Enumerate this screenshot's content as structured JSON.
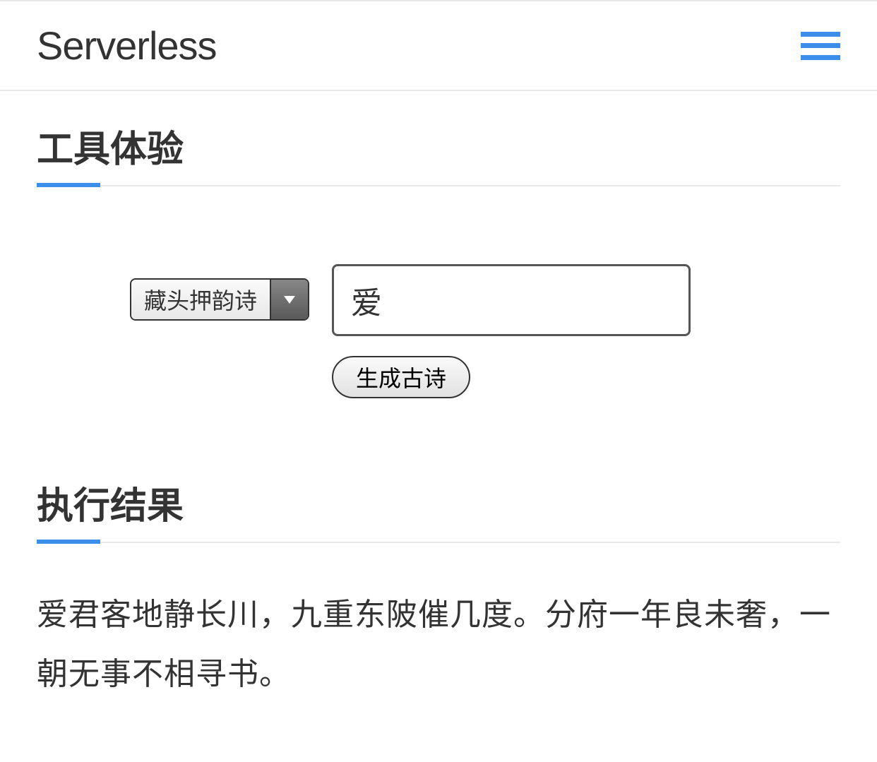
{
  "header": {
    "brand": "Serverless"
  },
  "sections": {
    "tool_title": "工具体验",
    "result_title": "执行结果"
  },
  "form": {
    "select_value": "藏头押韵诗",
    "input_value": "爱",
    "submit_label": "生成古诗"
  },
  "result": {
    "text": "爱君客地静长川，九重东陂催几度。分府一年良未奢，一朝无事不相寻书。"
  }
}
